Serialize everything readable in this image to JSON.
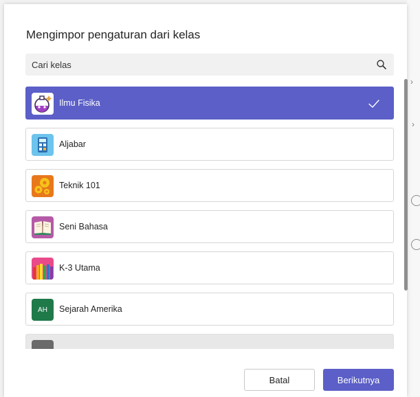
{
  "dialog": {
    "title": "Mengimpor pengaturan dari kelas",
    "search": {
      "placeholder": "Cari kelas"
    },
    "classes": [
      {
        "label": "Ilmu Fisika",
        "icon": "science-flask-icon",
        "selected": true
      },
      {
        "label": "Aljabar",
        "icon": "calculator-icon",
        "selected": false
      },
      {
        "label": "Teknik 101",
        "icon": "gears-icon",
        "selected": false
      },
      {
        "label": "Seni Bahasa",
        "icon": "open-book-icon",
        "selected": false
      },
      {
        "label": "K-3 Utama",
        "icon": "colored-pencils-icon",
        "selected": false
      },
      {
        "label": "Sejarah Amerika",
        "icon": "initials-avatar",
        "initials": "AH",
        "selected": false
      }
    ],
    "buttons": {
      "cancel": "Batal",
      "next": "Berikutnya"
    }
  },
  "colors": {
    "accent": "#5b5fc7",
    "search_bg": "#f1f1f1",
    "initials_bg": "#1f7a4a"
  }
}
